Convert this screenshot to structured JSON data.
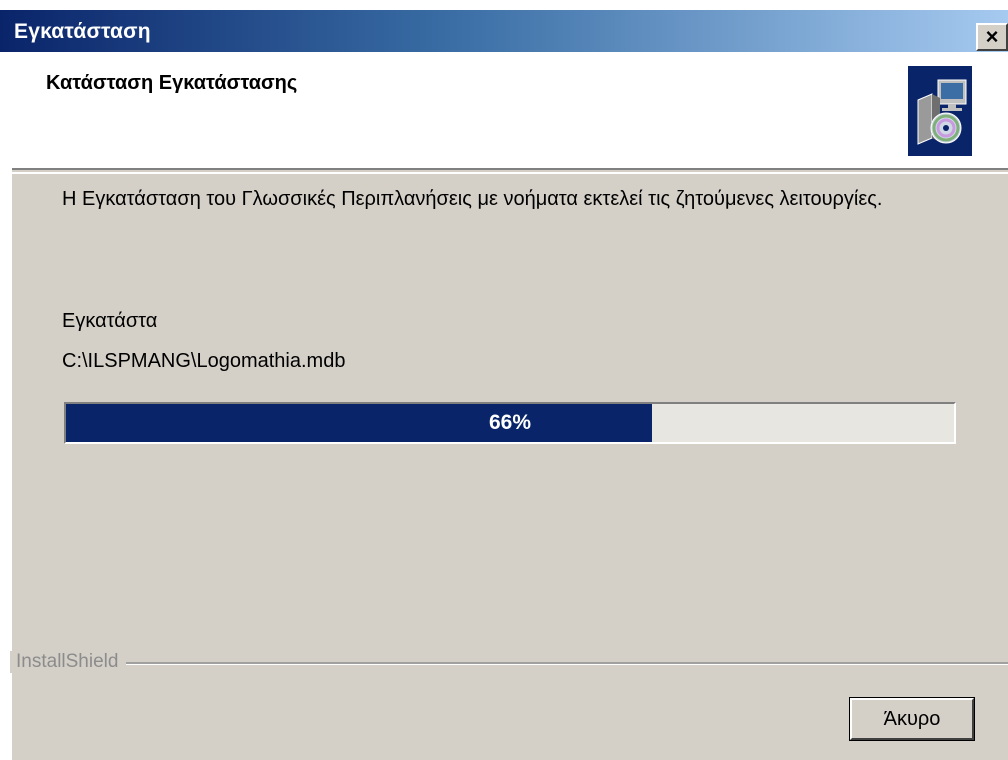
{
  "window": {
    "title": "Εγκατάσταση",
    "close_label": "×"
  },
  "header": {
    "title": "Κατάσταση Εγκατάστασης",
    "icon": "installer-disc-computer-icon"
  },
  "body": {
    "description": "Η Εγκατάσταση του Γλωσσικές Περιπλανήσεις  με νοήματα εκτελεί τις ζητούμενες λειτουργίες.",
    "action": "Εγκατάστα",
    "file_path": "C:\\ILSPMANG\\Logomathia.mdb"
  },
  "progress": {
    "percent": 66,
    "label": "66%"
  },
  "footer": {
    "brand": "InstallShield",
    "cancel_label": "Άκυρο"
  },
  "colors": {
    "title_bar_start": "#0a246a",
    "title_bar_end": "#a6caf0",
    "progress_fill": "#0a246a",
    "dialog_face": "#d4d0c8"
  }
}
